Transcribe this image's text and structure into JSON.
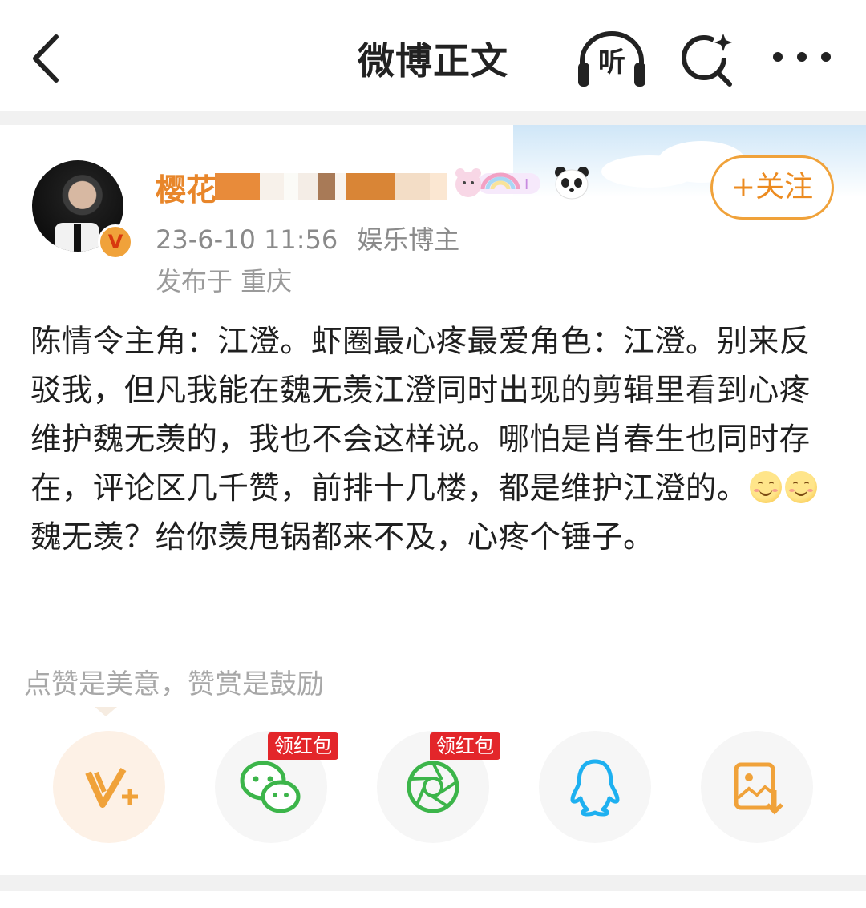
{
  "header": {
    "title": "微博正文",
    "listen_label": "听"
  },
  "post": {
    "username": "樱花",
    "timestamp": "23-6-10 11:56",
    "author_type": "娱乐博主",
    "location": "发布于 重庆",
    "follow_label": "+关注",
    "text": [
      "陈情令主角：江澄。虾圈最心疼最爱角色：江澄。别来反驳我，但凡我能在魏无羡江澄同时出现的剪辑里看到心疼维护魏无羡的，我也不会这样说。哪怕是肖春生也同时存在，评论区几千赞，前排十几楼，都是维护江澄的。",
      " 魏无羡？给你羡甩锅都来不及，心疼个锤子。"
    ]
  },
  "reward": {
    "hint": "点赞是美意，赞赏是鼓励",
    "share_targets": [
      {
        "icon": "vip-plus-icon",
        "color": "#f0a23a"
      },
      {
        "icon": "wechat-icon",
        "color": "#3cb54a",
        "tag": "领红包"
      },
      {
        "icon": "moments-icon",
        "color": "#3cb54a",
        "tag": "领红包"
      },
      {
        "icon": "qq-icon",
        "color": "#1eb0f0"
      },
      {
        "icon": "save-image-icon",
        "color": "#f0a23a"
      }
    ]
  },
  "colors": {
    "accent": "#f0a23a",
    "username": "#e8862a",
    "red_tag": "#e3262a"
  }
}
